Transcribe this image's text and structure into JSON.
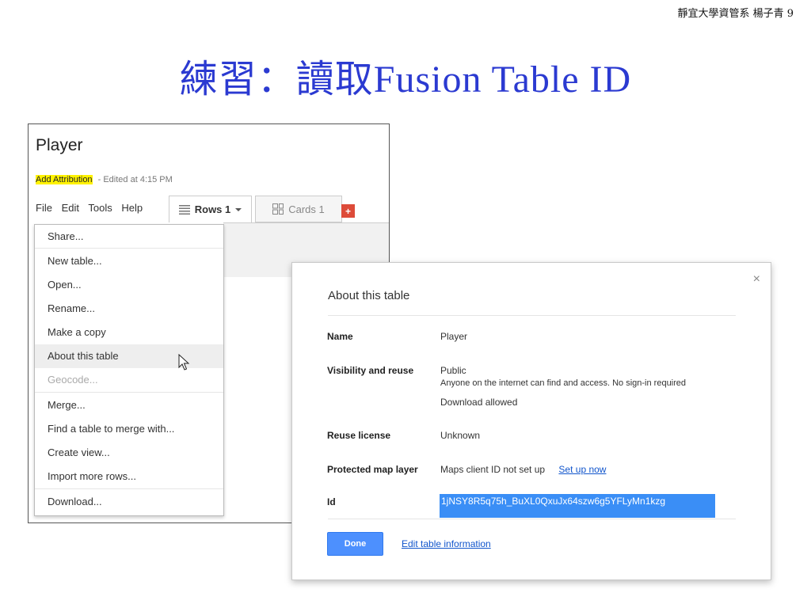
{
  "slide": {
    "corner_note": "靜宜大學資管系 楊子青 9",
    "title": "練習：讀取Fusion Table ID"
  },
  "table": {
    "name": "Player",
    "attribution_link": "Add Attribution",
    "edited_text": "- Edited at 4:15 PM"
  },
  "menubar": [
    "File",
    "Edit",
    "Tools",
    "Help"
  ],
  "tabs": {
    "rows_label": "Rows 1",
    "cards_label": "Cards 1",
    "add_label": "+"
  },
  "file_menu": {
    "items": [
      "Share...",
      "New table...",
      "Open...",
      "Rename...",
      "Make a copy",
      "About this table",
      "Geocode...",
      "Merge...",
      "Find a table to merge with...",
      "Create view...",
      "Import more rows...",
      "Download..."
    ],
    "hovered_item": "About this table",
    "disabled_item": "Geocode..."
  },
  "dialog": {
    "close": "×",
    "title": "About this table",
    "name_label": "Name",
    "name_value": "Player",
    "visibility_label": "Visibility and reuse",
    "visibility_value": "Public",
    "visibility_desc": "Anyone on the internet can find and access. No sign-in required",
    "download_value": "Download allowed",
    "license_label": "Reuse license",
    "license_value": "Unknown",
    "map_label": "Protected map layer",
    "map_value": "Maps client ID not set up",
    "map_link": "Set up now",
    "id_label": "Id",
    "id_value": "1jNSY8R5q75h_BuXL0QxuJx64szw6g5YFLyMn1kzg",
    "done_label": "Done",
    "edit_link": "Edit table information"
  },
  "colors": {
    "title": "#2b3ad1",
    "highlight": "#fff200",
    "selection": "#3a8ef6",
    "button": "#4d90fe",
    "add_tab": "#dd4b39",
    "link": "#1155cc"
  }
}
